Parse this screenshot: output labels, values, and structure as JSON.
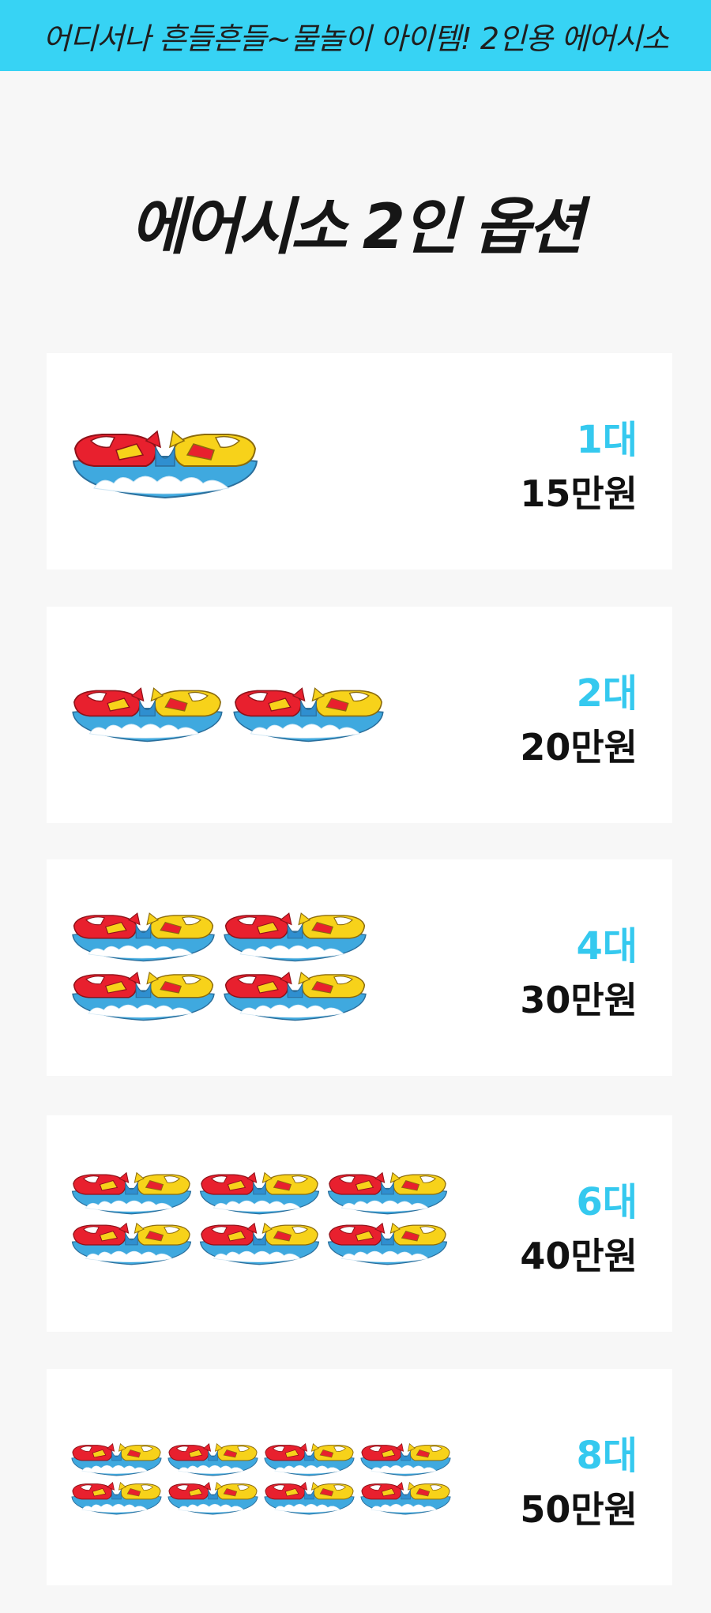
{
  "banner": {
    "text": "어디서나 흔들흔들~물놀이 아이템! 2인용 에어시소"
  },
  "page_title": "에어시소 2인 옵션",
  "options": [
    {
      "quantity": "1대",
      "price": "15만원",
      "units": 1
    },
    {
      "quantity": "2대",
      "price": "20만원",
      "units": 2
    },
    {
      "quantity": "4대",
      "price": "30만원",
      "units": 4
    },
    {
      "quantity": "6대",
      "price": "40만원",
      "units": 6
    },
    {
      "quantity": "8대",
      "price": "50만원",
      "units": 8
    }
  ],
  "colors": {
    "banner": "#37d3f4",
    "accent": "#35c9ef",
    "plane_red": "#e8202e",
    "plane_yellow": "#f7d21a",
    "sky_blue": "#3fa9df",
    "cloud": "#ffffff"
  },
  "icons": {
    "product": "air-seesaw-plane-icon"
  }
}
